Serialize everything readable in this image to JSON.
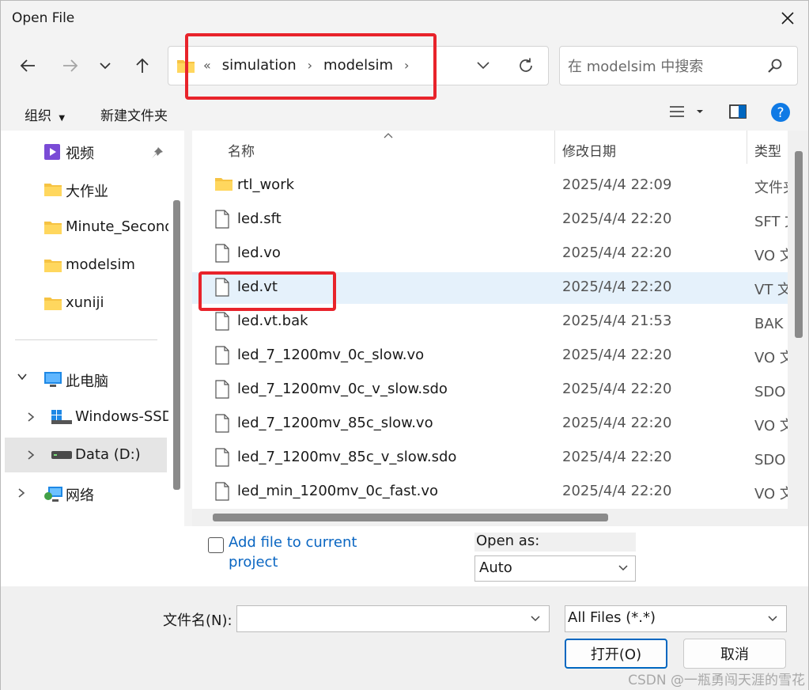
{
  "window": {
    "title": "Open File"
  },
  "address": {
    "overflow": "«",
    "crumbs": [
      "simulation",
      "modelsim"
    ]
  },
  "search": {
    "placeholder": "在 modelsim 中搜索"
  },
  "toolbar": {
    "organize": "组织",
    "new_folder": "新建文件夹"
  },
  "sidebar": {
    "quick_access": [
      {
        "label": "视频",
        "icon": "video-icon",
        "pinned": true
      },
      {
        "label": "大作业",
        "icon": "folder-icon"
      },
      {
        "label": "Minute_Second",
        "icon": "folder-icon"
      },
      {
        "label": "modelsim",
        "icon": "folder-icon"
      },
      {
        "label": "xuniji",
        "icon": "folder-icon"
      }
    ],
    "this_pc": {
      "label": "此电脑",
      "icon": "computer-icon"
    },
    "drives": [
      {
        "label": "Windows-SSD",
        "icon": "windows-drive-icon"
      },
      {
        "label": "Data (D:)",
        "icon": "drive-icon",
        "selected": true
      }
    ],
    "network": {
      "label": "网络",
      "icon": "network-icon"
    }
  },
  "columns": {
    "name": "名称",
    "modified": "修改日期",
    "type": "类型"
  },
  "files": [
    {
      "name": "rtl_work",
      "date": "2025/4/4 22:09",
      "type": "文件夹",
      "icon": "folder-icon"
    },
    {
      "name": "led.sft",
      "date": "2025/4/4 22:20",
      "type": "SFT 文件",
      "icon": "file-icon"
    },
    {
      "name": "led.vo",
      "date": "2025/4/4 22:20",
      "type": "VO 文件",
      "icon": "file-icon"
    },
    {
      "name": "led.vt",
      "date": "2025/4/4 22:20",
      "type": "VT 文件",
      "icon": "file-icon",
      "highlighted": true
    },
    {
      "name": "led.vt.bak",
      "date": "2025/4/4 21:53",
      "type": "BAK 文件",
      "icon": "file-icon"
    },
    {
      "name": "led_7_1200mv_0c_slow.vo",
      "date": "2025/4/4 22:20",
      "type": "VO 文件",
      "icon": "file-icon"
    },
    {
      "name": "led_7_1200mv_0c_v_slow.sdo",
      "date": "2025/4/4 22:20",
      "type": "SDO 文件",
      "icon": "file-icon"
    },
    {
      "name": "led_7_1200mv_85c_slow.vo",
      "date": "2025/4/4 22:20",
      "type": "VO 文件",
      "icon": "file-icon"
    },
    {
      "name": "led_7_1200mv_85c_v_slow.sdo",
      "date": "2025/4/4 22:20",
      "type": "SDO 文件",
      "icon": "file-icon"
    },
    {
      "name": "led_min_1200mv_0c_fast.vo",
      "date": "2025/4/4 22:20",
      "type": "VO 文件",
      "icon": "file-icon"
    }
  ],
  "options": {
    "add_to_project_label": "Add file to current project",
    "add_to_project_checked": false,
    "open_as_label": "Open as:",
    "open_as_value": "Auto"
  },
  "footer": {
    "filename_label": "文件名(N):",
    "filename_value": "",
    "filter_value": "All Files (*.*)",
    "open_button": "打开(O)",
    "cancel_button": "取消"
  },
  "watermark": "CSDN @一瓶勇闯天涯的雪花",
  "colors": {
    "accent": "#0067c0",
    "highlight_box": "#e8232b",
    "row_highlight": "#e5f1fb",
    "link": "#0a66c2"
  }
}
